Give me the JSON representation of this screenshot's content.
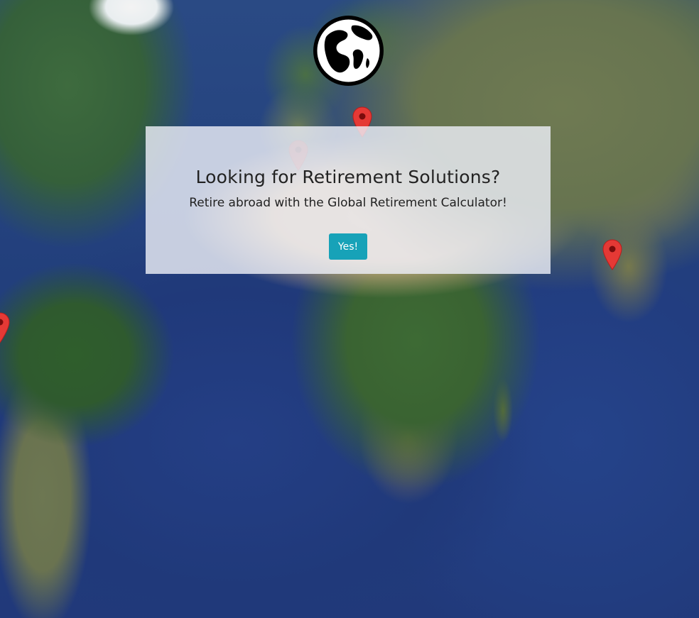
{
  "hero": {
    "title": "Looking for Retirement Solutions?",
    "subtitle": "Retire abroad with the Global Retirement Calculator!",
    "cta_label": "Yes!"
  },
  "logo": {
    "icon": "globe-icon"
  },
  "map": {
    "markers": [
      {
        "name": "map-marker-europe",
        "color": "#e53935"
      },
      {
        "name": "map-marker-spain",
        "color": "#e53935"
      },
      {
        "name": "map-marker-india",
        "color": "#e53935"
      },
      {
        "name": "map-marker-south-america",
        "color": "#e53935"
      }
    ]
  },
  "colors": {
    "button": "#17a2b8",
    "marker": "#e53935",
    "card_background": "rgba(235,238,246,0.82)"
  }
}
